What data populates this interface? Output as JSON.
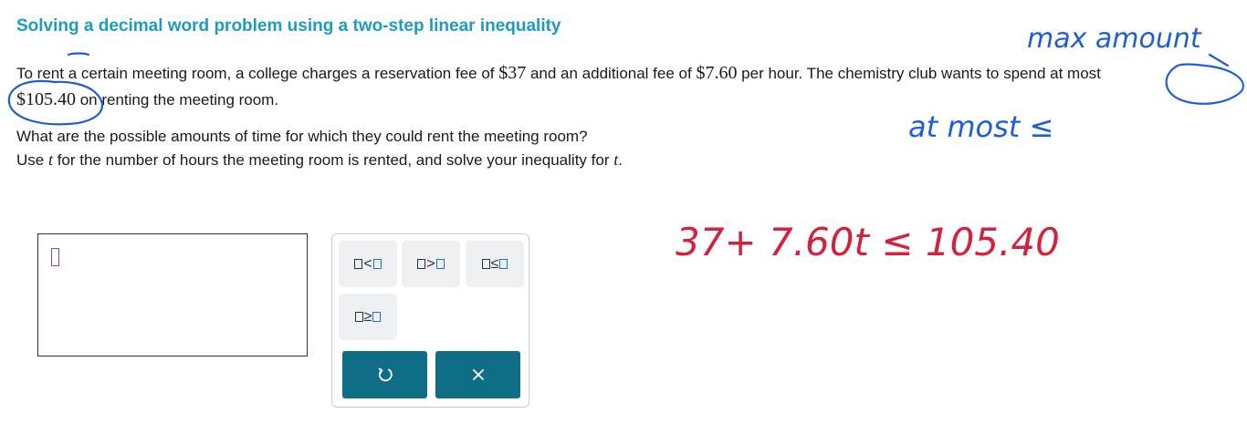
{
  "title": "Solving a decimal word problem using a two-step linear inequality",
  "problem": {
    "part1": "To rent a certain meeting room, a college charges a reservation fee of ",
    "fee1": "$37",
    "part2": " and an additional fee of ",
    "fee2": "$7.60",
    "part3": " per hour. The chemistry club wants to spend at most",
    "budget": "$105.40",
    "part4": " on renting the meeting room."
  },
  "question": {
    "line1": "What are the possible amounts of time for which they could rent the meeting room?",
    "line2_pre": "Use ",
    "variable": "t",
    "line2_mid": " for the number of hours the meeting room is rented, and solve your inequality for ",
    "line2_end": "."
  },
  "palette": {
    "keys": [
      "<",
      ">",
      "≤",
      "≥"
    ],
    "undo_icon": "undo-icon",
    "clear_icon": "close-icon"
  },
  "annotations": {
    "max_amount": "max amount",
    "at_most": "at most ≤",
    "inequality": "37+ 7.60t ≤ 105.40"
  },
  "colors": {
    "title": "#1e9bc0",
    "ink_blue": "#1f5fd6",
    "ink_red": "#d2233d",
    "button": "#0f6d86"
  }
}
